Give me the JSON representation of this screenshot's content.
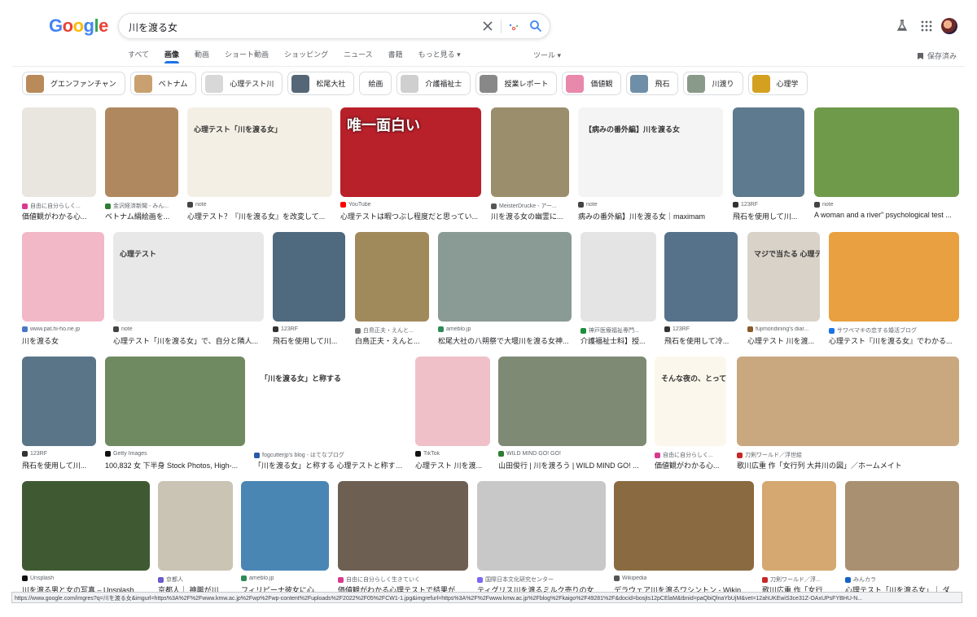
{
  "header": {
    "logo": [
      "G",
      "o",
      "o",
      "g",
      "l",
      "e"
    ],
    "logo_colors": [
      "#4285F4",
      "#EA4335",
      "#FBBC05",
      "#4285F4",
      "#34A853",
      "#EA4335"
    ],
    "query": "川を渡る女"
  },
  "tabs": [
    {
      "label": "すべて",
      "active": false
    },
    {
      "label": "画像",
      "active": true
    },
    {
      "label": "動画",
      "active": false
    },
    {
      "label": "ショート動画",
      "active": false
    },
    {
      "label": "ショッピング",
      "active": false
    },
    {
      "label": "ニュース",
      "active": false
    },
    {
      "label": "書籍",
      "active": false
    },
    {
      "label": "もっと見る ▾",
      "active": false
    }
  ],
  "tools_label": "ツール ▾",
  "saved_label": "保存済み",
  "chips": [
    {
      "label": "グエンファンチャン",
      "color": "#b98a5a"
    },
    {
      "label": "ベトナム",
      "color": "#c9a070"
    },
    {
      "label": "心理テスト川",
      "color": "#d8d8d8"
    },
    {
      "label": "松尾大社",
      "color": "#556677"
    },
    {
      "label": "絵画",
      "color": ""
    },
    {
      "label": "介護福祉士",
      "color": "#cfcfcf"
    },
    {
      "label": "授業レポート",
      "color": "#888888"
    },
    {
      "label": "価値観",
      "color": "#e888aa"
    },
    {
      "label": "飛石",
      "color": "#6f8fa8"
    },
    {
      "label": "川渡り",
      "color": "#8a9a8a"
    },
    {
      "label": "心理学",
      "color": "#d4a020"
    }
  ],
  "results": [
    {
      "source": "自由に自分らしく...",
      "title": "価値観がわかる心...",
      "color": "#e9e6df",
      "fav": "#d63b8f",
      "text": ""
    },
    {
      "source": "金沢経済新聞 - みん...",
      "title": "ベトナム絹絵画を...",
      "color": "#b08860",
      "fav": "#2e7d32",
      "text": ""
    },
    {
      "source": "note",
      "title": "心理テスト？『川を渡る女』を改変して...",
      "color": "#f3efe4",
      "fav": "#444444",
      "text": "心理テスト「川を渡る女」"
    },
    {
      "source": "YouTube",
      "title": "心理テストは暇つぶし程度だと思ってい...",
      "color": "#b8202a",
      "fav": "#ff0000",
      "text": "唯一面白い"
    },
    {
      "source": "MeisterDrucke - アー...",
      "title": "川を渡る女の幽霊に...",
      "color": "#9a8e6c",
      "fav": "#555555",
      "text": ""
    },
    {
      "source": "note",
      "title": "病みの番外編】川を渡る女｜maximam",
      "color": "#f4f4f4",
      "fav": "#444444",
      "text": "【病みの番外編】川を渡る女"
    },
    {
      "source": "123RF",
      "title": "飛石を使用して川...",
      "color": "#5d7a8e",
      "fav": "#333333",
      "text": ""
    },
    {
      "source": "note",
      "title": "A woman and a river\" psychological test ...",
      "color": "#6f9a4a",
      "fav": "#444444",
      "text": ""
    },
    {
      "source": "www.pat.hi-ho.ne.jp",
      "title": "川を渡る女",
      "color": "#f2b8c8",
      "fav": "#4a78c2",
      "text": ""
    },
    {
      "source": "note",
      "title": "心理テスト「川を渡る女」で、自分と隣人...",
      "color": "#e8e8e8",
      "fav": "#444444",
      "text": "心理テスト"
    },
    {
      "source": "123RF",
      "title": "飛石を使用して川...",
      "color": "#4f6a7e",
      "fav": "#333333",
      "text": ""
    },
    {
      "source": "白鳥正夫・えんと...",
      "title": "白鳥正夫・えんと...",
      "color": "#a08a5c",
      "fav": "#777777",
      "text": ""
    },
    {
      "source": "ameblo.jp",
      "title": "松尾大社の八朔祭で大堰川を渡る女神...",
      "color": "#8a9a94",
      "fav": "#2e8b57",
      "text": ""
    },
    {
      "source": "神戸医療福祉専門...",
      "title": "介護福祉士料】授...",
      "color": "#e4e4e4",
      "fav": "#1e8e3e",
      "text": ""
    },
    {
      "source": "123RF",
      "title": "飛石を使用して冷...",
      "color": "#56728a",
      "fav": "#333333",
      "text": ""
    },
    {
      "source": "fujimondining's diar...",
      "title": "心理テスト 川を渡...",
      "color": "#d9d2c8",
      "fav": "#8a5a2a",
      "text": "マジで当たる 心理テスト"
    },
    {
      "source": "サワペマキの恋する婚活ブログ",
      "title": "心理テスト『川を渡る女』でわかる...",
      "color": "#e8a040",
      "fav": "#1a73e8",
      "text": ""
    },
    {
      "source": "123RF",
      "title": "飛石を使用して川...",
      "color": "#5a7488",
      "fav": "#333333",
      "text": ""
    },
    {
      "source": "Getty Images",
      "title": "100,832 女 下半身 Stock Photos, High-...",
      "color": "#6f8a60",
      "fav": "#111111",
      "text": ""
    },
    {
      "source": "fogcutterjp's blog - はてなブログ",
      "title": "「川を渡る女」と称する 心理テストと称する...",
      "color": "#ffffff",
      "fav": "#2a5aa8",
      "text": "「川を渡る女」と称する"
    },
    {
      "source": "TikTok",
      "title": "心理テスト 川を渡...",
      "color": "#f0c0c8",
      "fav": "#111111",
      "text": ""
    },
    {
      "source": "WILD MIND GO! GO!",
      "title": "山田俊行 | 川を渡ろう | WILD MIND GO! ...",
      "color": "#7f8a74",
      "fav": "#2e7d32",
      "text": ""
    },
    {
      "source": "自由に自分らしく...",
      "title": "価値観がわかる心...",
      "color": "#fbf7ec",
      "fav": "#d63b8f",
      "text": "そんな夜の、とっておき"
    },
    {
      "source": "刀剣ワールド／浮世絵",
      "title": "歌川広重 作「女行列 大井川の図」／ホームメイト",
      "color": "#c9a880",
      "fav": "#c62828",
      "text": ""
    },
    {
      "source": "Unsplash",
      "title": "川を渡る男と女の写真 – Unsplash...",
      "color": "#3f5a32",
      "fav": "#111111",
      "text": ""
    },
    {
      "source": "京都人",
      "title": "京都人｜ 神輿が川...",
      "color": "#c9c4b4",
      "fav": "#6a5acd",
      "text": ""
    },
    {
      "source": "ameblo.jp",
      "title": "フィリピーナ彼女に心...",
      "color": "#4a86b4",
      "fav": "#2e8b57",
      "text": ""
    },
    {
      "source": "自由に自分らしく生きていく",
      "title": "価値観がわかる心理テストで結果が...",
      "color": "#6d5f52",
      "fav": "#d63b8f",
      "text": ""
    },
    {
      "source": "国際日本文化研究センター",
      "title": "ティグリス川を渡るミルク売りの女...",
      "color": "#c8c8c8",
      "fav": "#7b68ee",
      "text": ""
    },
    {
      "source": "Wikipedia",
      "title": "デラウェア川を渡るワシントン - Wikip...",
      "color": "#8a6a40",
      "fav": "#555555",
      "text": ""
    },
    {
      "source": "刀剣ワールド／浮...",
      "title": "歌川広重 作「女行...",
      "color": "#d4a870",
      "fav": "#c62828",
      "text": ""
    },
    {
      "source": "みんカラ",
      "title": "心理テスト「川を渡る女」｜ ダ...",
      "color": "#a89070",
      "fav": "#1565c0",
      "text": ""
    }
  ],
  "status_url": "https://www.google.com/imgres?q=川を渡る女&imgurl=https%3A%2F%2Fwww.kmw.ac.jp%2Fwp%2Fwp-content%2Fuploads%2F2022%2F05%2FCW1-1.jpg&imgrefurl=https%3A%2F%2Fwww.kmw.ac.jp%2Fblog%2Fkaigo%2F49281%2F&docid=bosjts12pCElaM&tbnid=paQbiQlnaYbUjM&vet=12ahUKEwiS3ce31Z-OAxUPsFYBHU-N..."
}
